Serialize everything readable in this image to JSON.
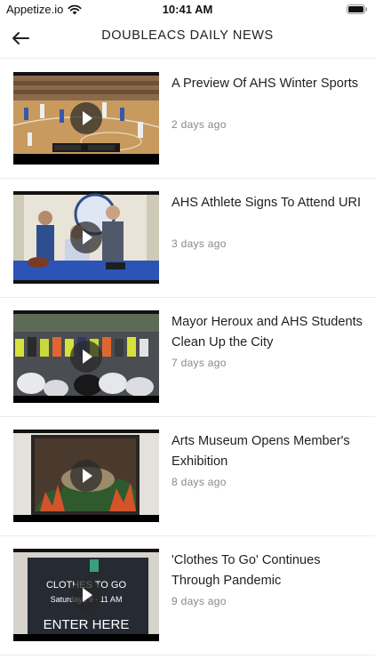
{
  "status_bar": {
    "carrier": "Appetize.io",
    "time": "10:41 AM"
  },
  "header": {
    "title": "DOUBLEACS DAILY NEWS",
    "back_icon": "arrow-left-icon"
  },
  "news": [
    {
      "title": "A Preview Of AHS Winter Sports",
      "time": "2 days ago"
    },
    {
      "title": "AHS Athlete Signs To Attend URI",
      "time": "3 days ago"
    },
    {
      "title": "Mayor Heroux and AHS Students Clean Up the City",
      "time": "7 days ago"
    },
    {
      "title": "Arts Museum Opens Member's Exhibition",
      "time": "8 days ago"
    },
    {
      "title": "'Clothes To Go' Continues Through Pandemic",
      "time": "9 days ago"
    }
  ],
  "thumbnail_text": {
    "sign_line1": "CLOTHES TO GO",
    "sign_line2": "Saturdays 9 - 11 AM",
    "sign_line3": "ENTER HERE"
  }
}
